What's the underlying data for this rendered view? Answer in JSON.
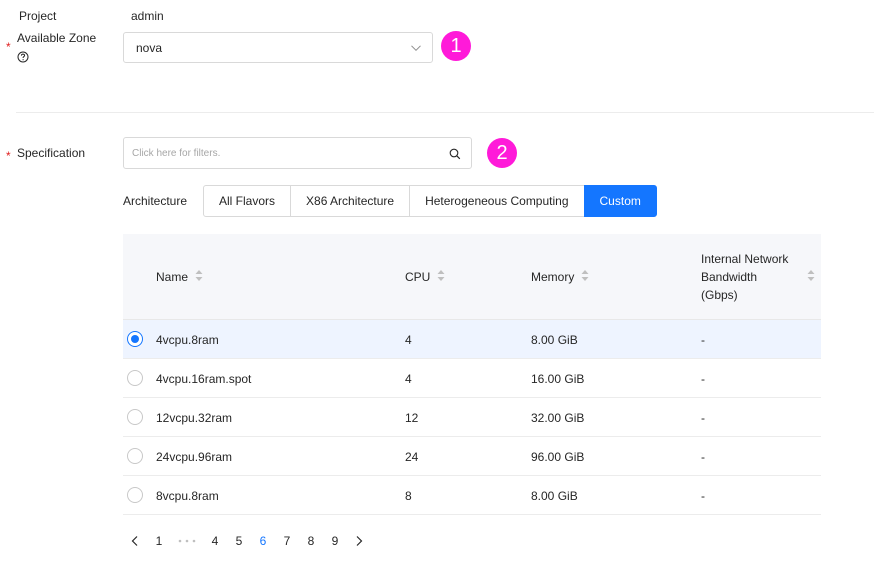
{
  "project": {
    "label": "Project",
    "value": "admin"
  },
  "available_zone": {
    "label": "Available Zone",
    "required_mark": "*",
    "help_icon": "question-circle-icon",
    "selected": "nova",
    "dropdown_icon": "chevron-down-icon"
  },
  "step_badges": [
    "1",
    "2"
  ],
  "specification": {
    "label": "Specification",
    "required_mark": "*",
    "search_placeholder": "Click here for filters.",
    "search_icon": "search-icon"
  },
  "architecture": {
    "label": "Architecture",
    "tabs": [
      "All Flavors",
      "X86 Architecture",
      "Heterogeneous Computing",
      "Custom"
    ],
    "active_tab": "Custom"
  },
  "flavor_table": {
    "columns": [
      "Name",
      "CPU",
      "Memory",
      "Internal Network Bandwidth (Gbps)"
    ],
    "column_lines": {
      "bandwidth": [
        "Internal Network",
        "Bandwidth",
        "(Gbps)"
      ]
    },
    "sort_icon": "sort-caret-icon",
    "rows": [
      {
        "name": "4vcpu.8ram",
        "cpu": "4",
        "memory": "8.00 GiB",
        "bandwidth": "-",
        "selected": true
      },
      {
        "name": "4vcpu.16ram.spot",
        "cpu": "4",
        "memory": "16.00 GiB",
        "bandwidth": "-",
        "selected": false
      },
      {
        "name": "12vcpu.32ram",
        "cpu": "12",
        "memory": "32.00 GiB",
        "bandwidth": "-",
        "selected": false
      },
      {
        "name": "24vcpu.96ram",
        "cpu": "24",
        "memory": "96.00 GiB",
        "bandwidth": "-",
        "selected": false
      },
      {
        "name": "8vcpu.8ram",
        "cpu": "8",
        "memory": "8.00 GiB",
        "bandwidth": "-",
        "selected": false
      }
    ]
  },
  "pagination": {
    "pages": [
      "1",
      "4",
      "5",
      "6",
      "7",
      "8",
      "9"
    ],
    "current": "6",
    "prev_icon": "chevron-left-icon",
    "next_icon": "chevron-right-icon",
    "ellipsis_icon": "ellipsis-icon"
  },
  "colors": {
    "accent": "#1476ff",
    "badge": "#ff1ad9",
    "required": "#e02020",
    "selected_row": "#eef4ff"
  }
}
